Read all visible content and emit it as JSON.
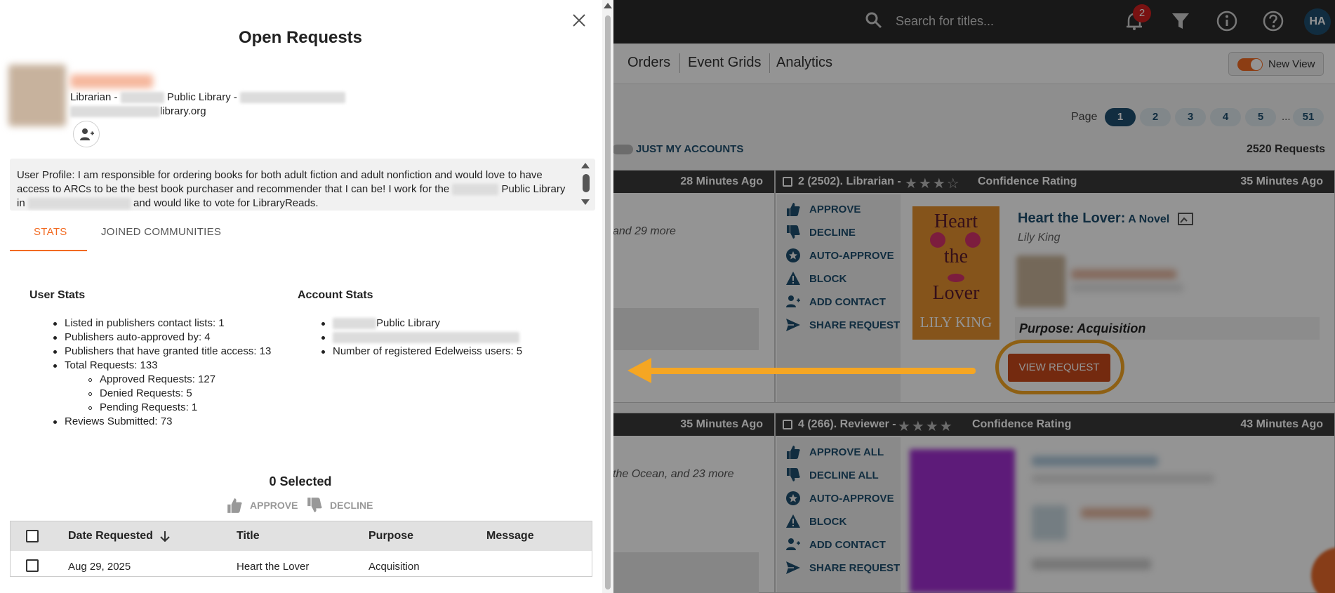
{
  "modal": {
    "title": "Open Requests",
    "user": {
      "line1_prefix": "Librarian - ",
      "line1_middle": " Public Library - ",
      "line2_suffix": "library.org"
    },
    "profile_text_1": "User Profile: I am responsible for ordering books for both adult fiction and adult nonfiction and would love to have access to ARCs to be the best book purchaser and recommender that I can be! I work for the ",
    "profile_text_2": " Public Library in ",
    "profile_text_3": " and would like to vote for LibraryReads.",
    "tabs": [
      {
        "label": "STATS",
        "active": true
      },
      {
        "label": "JOINED COMMUNITIES",
        "active": false
      }
    ],
    "user_stats": {
      "heading": "User Stats",
      "items": [
        "Listed in publishers contact lists: 1",
        "Publishers auto-approved by: 4",
        "Publishers that have granted title access: 13",
        "Total Requests: 133",
        "Approved Requests: 127",
        "Denied Requests: 5",
        "Pending Requests: 1",
        "Reviews Submitted: 73"
      ]
    },
    "account_stats": {
      "heading": "Account Stats",
      "item1_suffix": "Public Library",
      "item3": "Number of registered Edelweiss users: 5"
    },
    "selected_label": "0 Selected",
    "bulk_actions": {
      "approve": "APPROVE",
      "decline": "DECLINE"
    },
    "table": {
      "headers": [
        "Date Requested",
        "Title",
        "Purpose",
        "Message"
      ],
      "rows": [
        {
          "date": "Aug 29, 2025",
          "title": "Heart the Lover",
          "purpose": "Acquisition",
          "message": ""
        }
      ]
    }
  },
  "background": {
    "search_placeholder": "Search for titles...",
    "notification_count": "2",
    "avatar_initials": "HA",
    "nav": [
      "Orders",
      "Event Grids",
      "Analytics"
    ],
    "new_view_label": "New View",
    "page_label": "Page",
    "pages": [
      "1",
      "2",
      "3",
      "4",
      "5",
      "51"
    ],
    "page_ellipsis": "...",
    "just_my_accounts": "JUST MY ACCOUNTS",
    "request_count": "2520 Requests",
    "left_card1_time": "28 Minutes Ago",
    "left_card1_more": "and 29 more",
    "left_card2_time": "35 Minutes Ago",
    "left_card2_more": "the Ocean, and 23 more",
    "card1": {
      "header": "2 (2502). Librarian -",
      "stars": "★★★☆",
      "confidence": "Confidence Rating",
      "time": "35 Minutes Ago",
      "actions": [
        "APPROVE",
        "DECLINE",
        "AUTO-APPROVE",
        "BLOCK",
        "ADD CONTACT",
        "SHARE REQUEST"
      ],
      "book_title": "Heart the Lover:",
      "book_subtitle": " A Novel",
      "author": "Lily King",
      "cover_lines": [
        "Heart",
        "the",
        "Lover",
        "LILY KING"
      ],
      "purpose": "Purpose: Acquisition",
      "view_request": "VIEW REQUEST"
    },
    "card2": {
      "header": "4 (266). Reviewer -",
      "stars": "★★★★",
      "confidence": "Confidence Rating",
      "time": "43 Minutes Ago",
      "actions": [
        "APPROVE ALL",
        "DECLINE ALL",
        "AUTO-APPROVE",
        "BLOCK",
        "ADD CONTACT",
        "SHARE REQUEST"
      ]
    },
    "colors": {
      "accent": "#f26a21",
      "navy": "#1e4f6e",
      "highlight": "#f5a623",
      "header": "#3a3a3a"
    }
  }
}
